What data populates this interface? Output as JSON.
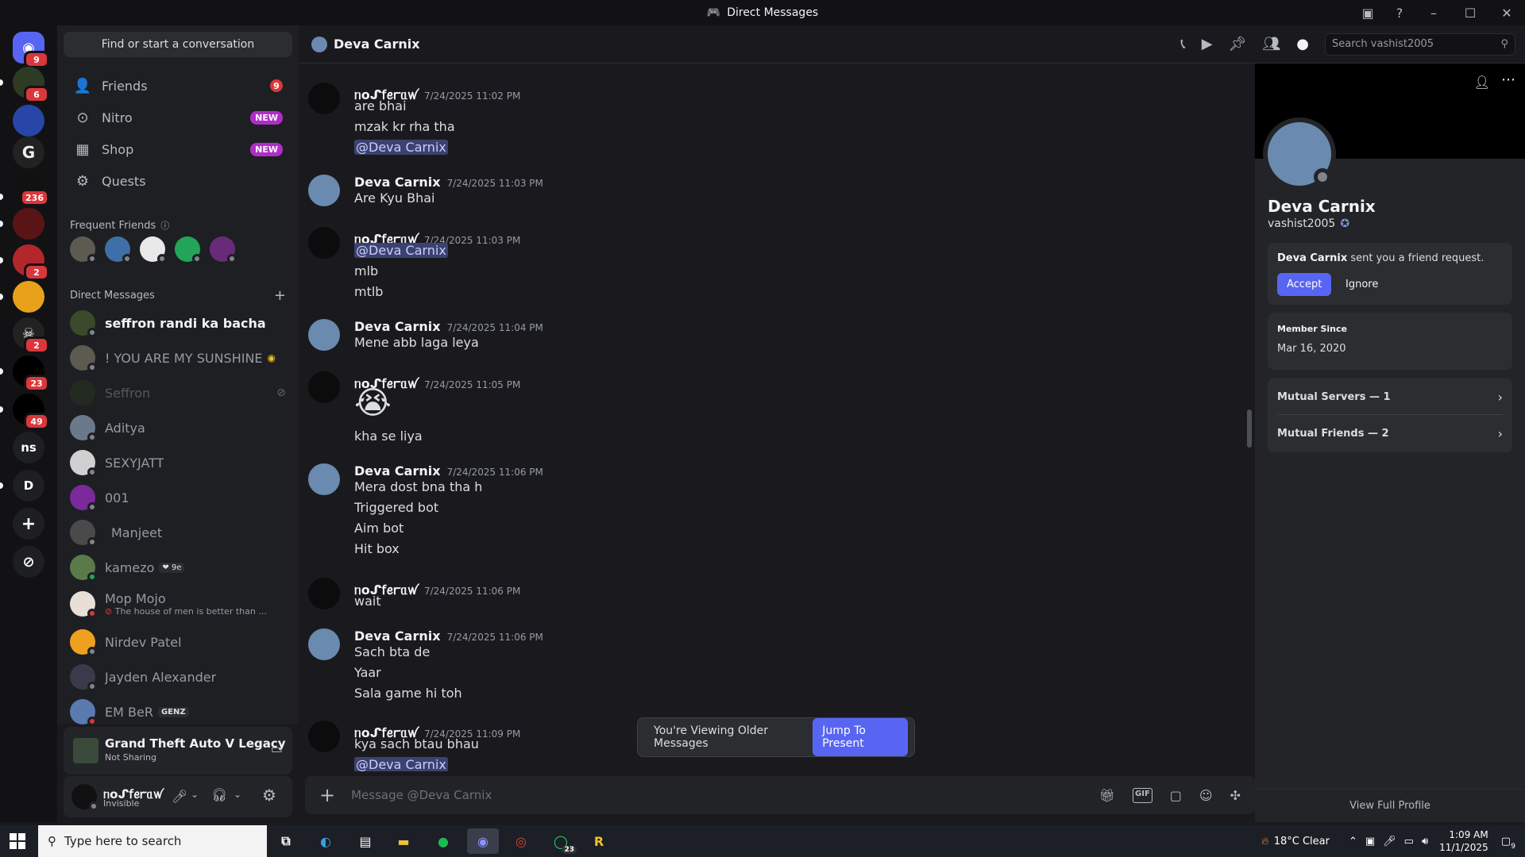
{
  "window": {
    "title": "Direct Messages"
  },
  "rail": {
    "servers": [
      {
        "badge": "9"
      },
      {
        "badge": "6"
      },
      {
        "badge": ""
      },
      {
        "badge": ""
      },
      {
        "badge": "236"
      },
      {
        "badge": ""
      },
      {
        "badge": "2"
      },
      {
        "badge": ""
      },
      {
        "badge": "2"
      },
      {
        "badge": "23"
      },
      {
        "badge": "49"
      },
      {
        "badge": "",
        "label": "ns"
      },
      {
        "badge": "",
        "label": "D"
      }
    ]
  },
  "sidebar": {
    "search_label": "Find or start a conversation",
    "nav": [
      {
        "label": "Friends",
        "badge": "9"
      },
      {
        "label": "Nitro",
        "badge": "NEW"
      },
      {
        "label": "Shop",
        "badge": "NEW"
      },
      {
        "label": "Quests",
        "badge": ""
      }
    ],
    "frequent_friends_label": "Frequent Friends",
    "dm_header": "Direct Messages",
    "dms": [
      {
        "name": "seffron randi ka bacha",
        "status": ""
      },
      {
        "name": "! YOU ARE MY SUNSHINE",
        "status": ""
      },
      {
        "name": "Seffron",
        "status": ""
      },
      {
        "name": "Aditya",
        "status": ""
      },
      {
        "name": "SEXYJATT",
        "status": ""
      },
      {
        "name": "001",
        "status": ""
      },
      {
        "name": "Manjeet",
        "status": ""
      },
      {
        "name": "kamezo",
        "status": "",
        "tag": "❤ 9e"
      },
      {
        "name": "Mop Mojo",
        "status": "The house of men is better than ..."
      },
      {
        "name": "Nirdev Patel",
        "status": ""
      },
      {
        "name": "Jayden Alexander",
        "status": ""
      },
      {
        "name": "EM BeR",
        "status": "",
        "tag": "GENZ"
      }
    ]
  },
  "activity": {
    "game": "Grand Theft Auto V Legacy",
    "sub": "Not Sharing"
  },
  "user": {
    "name": "ᥒoᔑ𝖿ꫀꭈᥲꪝ",
    "status": "Invisible"
  },
  "chat": {
    "header_name": "Deva Carnix",
    "search_placeholder": "Search vashist2005",
    "messages": [
      {
        "author": "ᥒoᔑ𝖿ꫀꭈᥲꪝ",
        "time": "7/24/2025 11:02 PM",
        "lines": [
          "are bhai",
          "mzak kr rha tha",
          "@Deva Carnix"
        ]
      },
      {
        "author": "Deva Carnix",
        "time": "7/24/2025 11:03 PM",
        "lines": [
          "Are Kyu Bhai"
        ]
      },
      {
        "author": "ᥒoᔑ𝖿ꫀꭈᥲꪝ",
        "time": "7/24/2025 11:03 PM",
        "lines": [
          "@Deva Carnix",
          "mlb",
          "mtlb"
        ]
      },
      {
        "author": "Deva Carnix",
        "time": "7/24/2025 11:04 PM",
        "lines": [
          "Mene  abb laga leya"
        ]
      },
      {
        "author": "ᥒoᔑ𝖿ꫀꭈᥲꪝ",
        "time": "7/24/2025 11:05 PM",
        "lines": [
          "😭",
          "kha se liya"
        ]
      },
      {
        "author": "Deva Carnix",
        "time": "7/24/2025 11:06 PM",
        "lines": [
          "Mera dost bna tha h",
          "Triggered bot",
          "Aim bot",
          "Hit box"
        ]
      },
      {
        "author": "ᥒoᔑ𝖿ꫀꭈᥲꪝ",
        "time": "7/24/2025 11:06 PM",
        "lines": [
          "wait"
        ]
      },
      {
        "author": "Deva Carnix",
        "time": "7/24/2025 11:06 PM",
        "lines": [
          "Sach bta de",
          "Yaar",
          "Sala game hi toh"
        ]
      },
      {
        "author": "ᥒoᔑ𝖿ꫀꭈᥲꪝ",
        "time": "7/24/2025 11:09 PM",
        "lines": [
          "kya sach btau bhau",
          "@Deva Carnix"
        ]
      }
    ],
    "older_label": "You're Viewing Older Messages",
    "jump_label": "Jump To Present",
    "composer_placeholder": "Message @Deva Carnix"
  },
  "profile": {
    "name": "Deva Carnix",
    "username": "vashist2005",
    "request_name": "Deva Carnix",
    "request_text": " sent you a friend request.",
    "accept": "Accept",
    "ignore": "Ignore",
    "member_since_label": "Member Since",
    "member_since": "Mar 16, 2020",
    "mutual_servers": "Mutual Servers — 1",
    "mutual_friends": "Mutual Friends — 2",
    "view_full": "View Full Profile"
  },
  "taskbar": {
    "search_placeholder": "Type here to search",
    "whatsapp_badge": "23",
    "weather": "18°C  Clear",
    "time": "1:09 AM",
    "date": "11/1/2025",
    "notif_badge": "9"
  }
}
